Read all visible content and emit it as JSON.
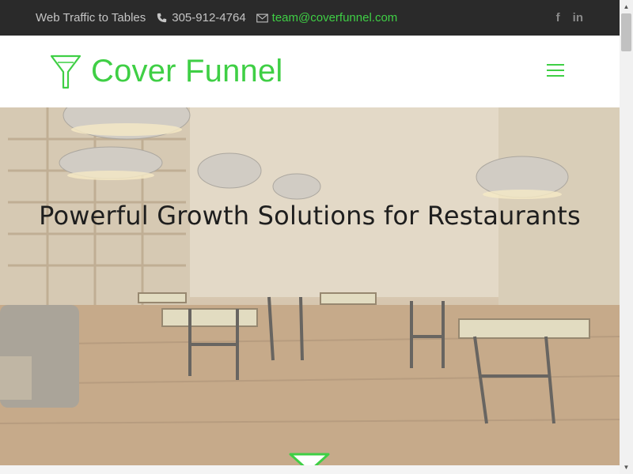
{
  "topbar": {
    "tagline": "Web Traffic to Tables",
    "phone": "305-912-4764",
    "email": "team@coverfunnel.com",
    "social": [
      {
        "icon": "facebook-icon",
        "glyph": "f"
      },
      {
        "icon": "linkedin-icon",
        "glyph": "in"
      }
    ]
  },
  "header": {
    "logo_text": "Cover Funnel",
    "menu_icon": "hamburger-menu-icon"
  },
  "hero": {
    "title": "Powerful Growth Solutions for Restaurants"
  },
  "colors": {
    "brand_green": "#3fcf45",
    "topbar_bg": "#2a2a2a",
    "topbar_text": "#c4c4c4",
    "hero_title": "#1e1e1e"
  }
}
